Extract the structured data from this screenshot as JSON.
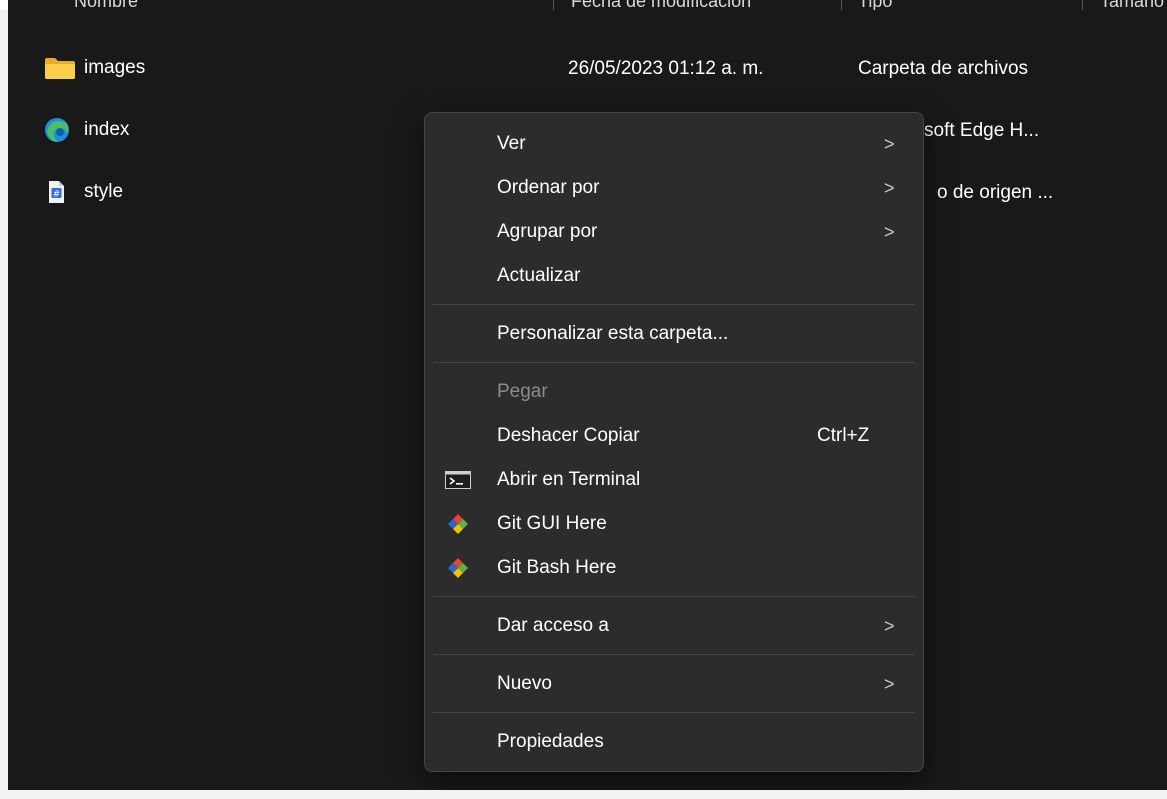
{
  "header": {
    "col_name": "Nombre",
    "col_date": "Fecha de modificación",
    "col_type": "Tipo",
    "col_size": "Tamaño"
  },
  "files": [
    {
      "name": "images",
      "icon": "folder-icon",
      "date": "26/05/2023 01:12 a. m.",
      "type": "Carpeta de archivos"
    },
    {
      "name": "index",
      "icon": "edge-icon",
      "type_visible": "soft Edge H..."
    },
    {
      "name": "style",
      "icon": "css-file-icon",
      "type_visible": "o de origen ..."
    }
  ],
  "menu": {
    "items": [
      {
        "label": "Ver",
        "submenu": ">"
      },
      {
        "label": "Ordenar por",
        "submenu": ">"
      },
      {
        "label": "Agrupar por",
        "submenu": ">"
      },
      {
        "label": "Actualizar"
      },
      {
        "label": "Personalizar esta carpeta..."
      },
      {
        "label": "Pegar",
        "disabled": true
      },
      {
        "label": "Deshacer Copiar",
        "shortcut": "Ctrl+Z"
      },
      {
        "label": "Abrir en Terminal",
        "icon": "terminal-icon"
      },
      {
        "label": "Git GUI Here",
        "icon": "git-gui-icon"
      },
      {
        "label": "Git Bash Here",
        "icon": "git-bash-icon"
      },
      {
        "label": "Dar acceso a",
        "submenu": ">"
      },
      {
        "label": "Nuevo",
        "submenu": ">"
      },
      {
        "label": "Propiedades"
      }
    ]
  },
  "colors": {
    "background": "#191919",
    "menu_background": "#2c2c2c",
    "folder": "#f4c542",
    "edge_blue": "#1f8ddf",
    "edge_green": "#4fc45c"
  }
}
